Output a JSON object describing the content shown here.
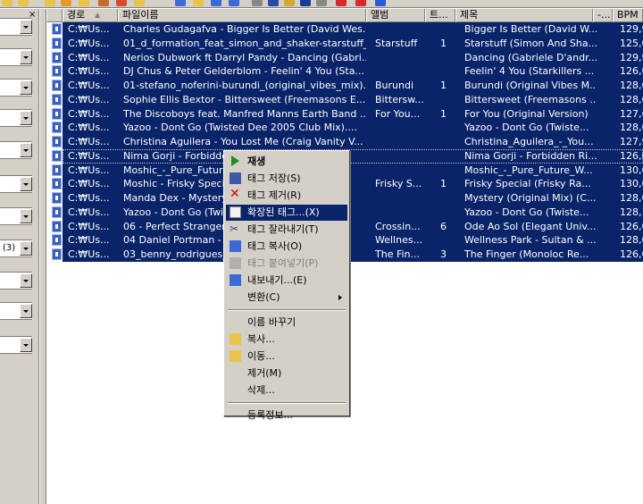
{
  "left_panel": {
    "close_glyph": "×",
    "combo_texts": [
      "",
      "",
      "",
      "",
      "",
      "",
      "",
      "(3)",
      "",
      "",
      ""
    ]
  },
  "columns": [
    {
      "label": ""
    },
    {
      "label": "경로"
    },
    {
      "label": "파일이름"
    },
    {
      "label": "앨범"
    },
    {
      "label": "트..."
    },
    {
      "label": "제목"
    },
    {
      "label": "-..."
    },
    {
      "label": "BPM"
    }
  ],
  "sort_indicator": "▲",
  "rows": [
    {
      "path": "C:₩Us...",
      "filename": "Charles Gudagafva - Bigger Is Better (David Wes...",
      "album": "",
      "track": "",
      "title": "Bigger Is Better (David W...",
      "bpm": "129,9"
    },
    {
      "path": "C:₩Us...",
      "filename": "01_d_formation_feat_simon_and_shaker-starstuff_...",
      "album": "Starstuff",
      "track": "1",
      "title": "Starstuff (Simon And Sha...",
      "bpm": "125,0"
    },
    {
      "path": "C:₩Us...",
      "filename": "Nerios Dubwork ft Darryl Pandy - Dancing (Gabri...",
      "album": "",
      "track": "",
      "title": "Dancing (Gabriele D'andr...",
      "bpm": "129,9"
    },
    {
      "path": "C:₩Us...",
      "filename": "DJ Chus & Peter Gelderblom - Feelin' 4 You (Sta...",
      "album": "",
      "track": "",
      "title": "Feelin' 4 You (Starkillers ...",
      "bpm": "126,0"
    },
    {
      "path": "C:₩Us...",
      "filename": "01-stefano_noferini-burundi_(original_vibes_mix)...",
      "album": "Burundi",
      "track": "1",
      "title": "Burundi (Original Vibes M...",
      "bpm": "128,0"
    },
    {
      "path": "C:₩Us...",
      "filename": "Sophie Ellis Bextor - Bittersweet (Freemasons E...",
      "album": "Bittersw...",
      "track": "",
      "title": "Bittersweet (Freemasons ...",
      "bpm": "128,0"
    },
    {
      "path": "C:₩Us...",
      "filename": "The Discoboys feat. Manfred Manns Earth Band ...",
      "album": "For You...",
      "track": "1",
      "title": "For You (Original Version)",
      "bpm": "127,6"
    },
    {
      "path": "C:₩Us...",
      "filename": "Yazoo - Dont Go (Twisted Dee 2005 Club Mix)....",
      "album": "",
      "track": "",
      "title": "Yazoo - Dont Go (Twiste...",
      "bpm": "128,0"
    },
    {
      "path": "C:₩Us...",
      "filename": "Christina Aguilera - You Lost Me (Craig Vanity V...",
      "album": "",
      "track": "",
      "title": "Christina_Aguilera_-_You...",
      "bpm": "127,9"
    },
    {
      "path": "C:₩Us...",
      "filename": "Nima Gorji - Forbidden Ri...",
      "album": "",
      "track": "",
      "title": "Nima Gorji - Forbidden Ri...",
      "bpm": "126,0"
    },
    {
      "path": "C:₩Us...",
      "filename": "Moshic_-_Pure_Future_W...",
      "album": "",
      "track": "",
      "title": "Moshic_-_Pure_Future_W...",
      "bpm": "130,0"
    },
    {
      "path": "C:₩Us...",
      "filename": "Moshic - Frisky Special (F...",
      "album": "Frisky S...",
      "track": "1",
      "title": "Frisky Special (Frisky Ra...",
      "bpm": "130,0"
    },
    {
      "path": "C:₩Us...",
      "filename": "Manda Dex - Mystery (Or...",
      "album": "",
      "track": "",
      "title": "Mystery (Original Mix) (C...",
      "bpm": "128,0"
    },
    {
      "path": "C:₩Us...",
      "filename": "Yazoo - Dont Go (Twisted...",
      "album": "",
      "track": "",
      "title": "Yazoo - Dont Go (Twiste...",
      "bpm": "128,1"
    },
    {
      "path": "C:₩Us...",
      "filename": "06 - Perfect Stranger - Od...",
      "album": "Crossin...",
      "track": "6",
      "title": "Ode Ao Sol (Elegant Univ...",
      "bpm": "126,0"
    },
    {
      "path": "C:₩Us...",
      "filename": "04 Daniel Portman - Well...",
      "album": "Wellnes...",
      "track": "",
      "title": "Wellness Park - Sultan & ...",
      "bpm": "128,0"
    },
    {
      "path": "C:₩Us...",
      "filename": "03_benny_rodrigues_-_Th...",
      "album": "The Fin...",
      "track": "3",
      "title": "The Finger (Monoloc Re...",
      "bpm": "126,0"
    }
  ],
  "context_menu": [
    {
      "type": "item",
      "label": "재생",
      "icon": "play-icon",
      "bold": true
    },
    {
      "type": "item",
      "label": "태그 저장(S)",
      "icon": "save-icon"
    },
    {
      "type": "item",
      "label": "태그 제거(R)",
      "icon": "remove-x-icon"
    },
    {
      "type": "item",
      "label": "확장된 태그...(X)",
      "icon": "edit-tag-icon",
      "selected": true
    },
    {
      "type": "item",
      "label": "태그 잘라내기(T)",
      "icon": "scissors-icon"
    },
    {
      "type": "item",
      "label": "태그 복사(O)",
      "icon": "copy-icon"
    },
    {
      "type": "item",
      "label": "태그 붙여넣기(P)",
      "icon": "paste-icon",
      "disabled": true
    },
    {
      "type": "item",
      "label": "내보내기...(E)",
      "icon": "export-icon"
    },
    {
      "type": "item",
      "label": "변환(C)",
      "icon": "",
      "submenu": true
    },
    {
      "type": "separator"
    },
    {
      "type": "item",
      "label": "이름 바꾸기",
      "icon": ""
    },
    {
      "type": "item",
      "label": "복사...",
      "icon": "folder-copy-icon"
    },
    {
      "type": "item",
      "label": "이동...",
      "icon": "folder-move-icon"
    },
    {
      "type": "item",
      "label": "제거(M)",
      "icon": ""
    },
    {
      "type": "item",
      "label": "삭제...",
      "icon": ""
    },
    {
      "type": "separator"
    },
    {
      "type": "item",
      "label": "등록정보...",
      "icon": ""
    }
  ],
  "colors": {
    "selection": "#0a246a",
    "face": "#d4d0c8",
    "remove_red": "#d40000",
    "play_green": "#1c8c1c"
  }
}
